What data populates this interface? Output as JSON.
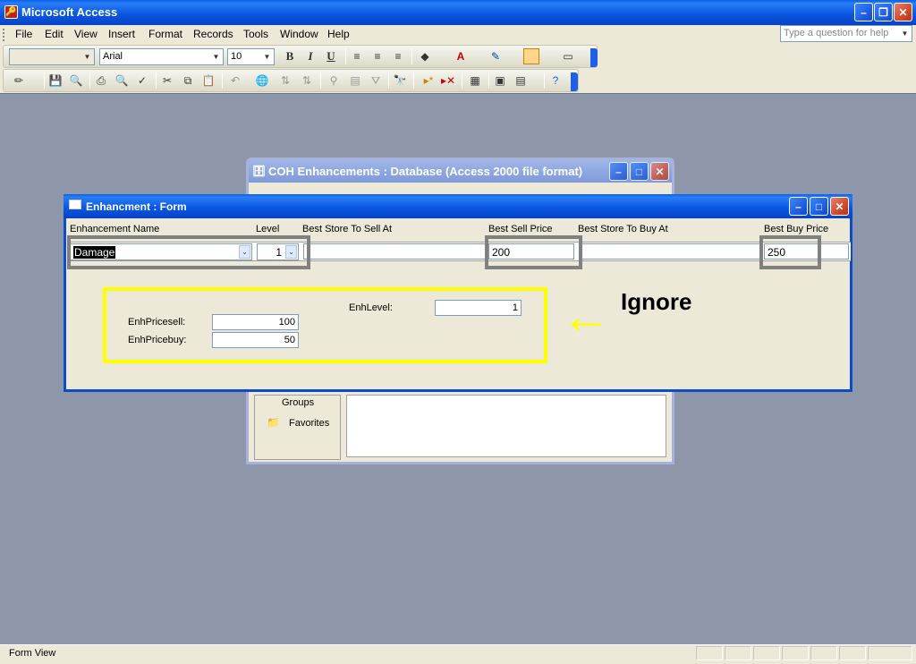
{
  "app": {
    "title": "Microsoft Access",
    "help_placeholder": "Type a question for help"
  },
  "menu": [
    "File",
    "Edit",
    "View",
    "Insert",
    "Format",
    "Records",
    "Tools",
    "Window",
    "Help"
  ],
  "formatting_toolbar": {
    "object_combo": "",
    "font_name": "Arial",
    "font_size": "10"
  },
  "db_window": {
    "title": "COH Enhancements : Database (Access 2000 file format)",
    "groups_label": "Groups",
    "favorites_label": "Favorites"
  },
  "form": {
    "title": "Enhancment : Form",
    "columns": {
      "name": "Enhancement Name",
      "level": "Level",
      "sell_store": "Best Store To Sell At",
      "sell_price": "Best Sell Price",
      "buy_store": "Best Store To Buy At",
      "buy_price": "Best Buy Price"
    },
    "row": {
      "name": "Damage",
      "level": "1",
      "sell_store": "",
      "sell_price": "200",
      "buy_store": "",
      "buy_price": "250"
    },
    "subform": {
      "enh_level_label": "EnhLevel:",
      "enh_level_value": "1",
      "price_sell_label": "EnhPricesell:",
      "price_sell_value": "100",
      "price_buy_label": "EnhPricebuy:",
      "price_buy_value": "50"
    }
  },
  "annotation": {
    "text": "Ignore",
    "arrow_glyph": "←",
    "color": "#ffff00"
  },
  "status_bar": {
    "text": "Form View"
  },
  "colors": {
    "titlebar": "#0a58e0",
    "workspace": "#8e96a9",
    "annotation": "#ffff00",
    "highlight_box": "#808080"
  }
}
